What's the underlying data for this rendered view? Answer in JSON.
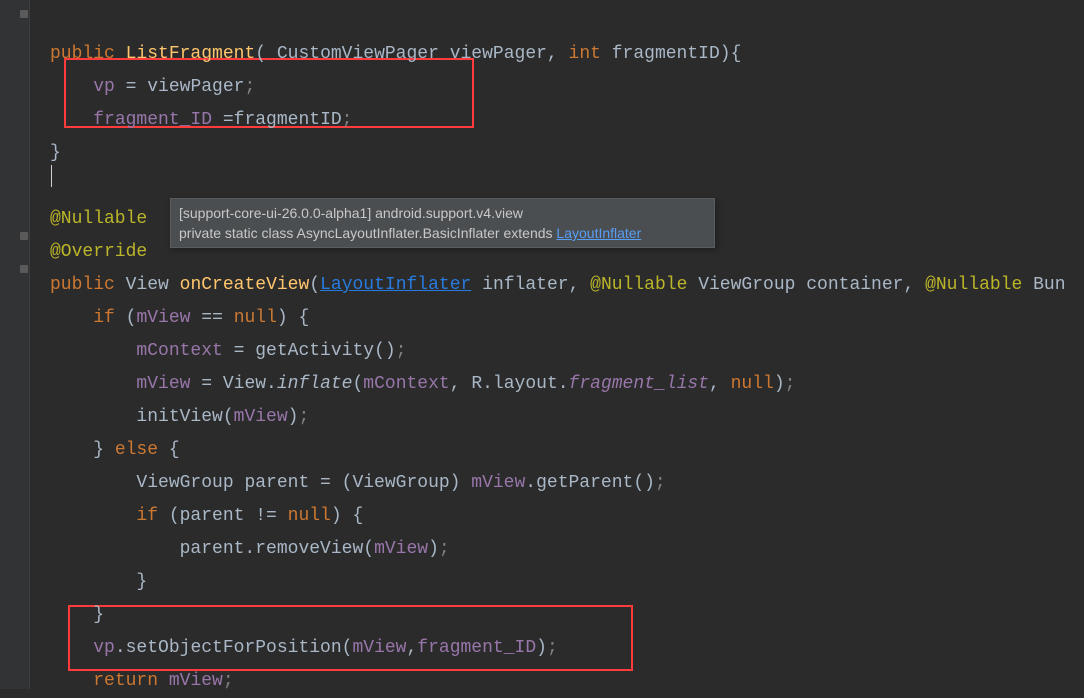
{
  "code": {
    "l1_public": "public",
    "l1_class": "ListFragment",
    "l1_paramType1": "CustomViewPager",
    "l1_paramName1": "viewPager",
    "l1_paramType2": "int",
    "l1_paramName2": "fragmentID",
    "l2_field": "vp",
    "l2_assign": " = viewPager",
    "l3_field": "fragment_ID",
    "l3_assign": " =fragmentID",
    "l4_brace": "}",
    "l6_anno": "@Nullable",
    "l7_anno": "@Override",
    "l8_public": "public",
    "l8_rettype": "View",
    "l8_method": "onCreateView",
    "l8_p1type": "LayoutInflater",
    "l8_p1name": "inflater",
    "l8_anno2": "@Nullable",
    "l8_p2type": "ViewGroup",
    "l8_p2name": "container",
    "l8_anno3": "@Nullable",
    "l8_p3type": "Bun",
    "l9_if": "if",
    "l9_cond_lhs": "mView",
    "l9_cond_op": " == ",
    "l9_cond_rhs": "null",
    "l10_lhs": "mContext",
    "l10_rhs": " = getActivity()",
    "l11_lhs": "mView",
    "l11_mid": " = View.",
    "l11_inflate": "inflate",
    "l11_p1": "mContext",
    "l11_p2a": "R.layout.",
    "l11_p2b": "fragment_list",
    "l11_p3": "null",
    "l12_call": "initView(",
    "l12_arg": "mView",
    "l13_else": "else",
    "l14_decl": "ViewGroup parent = (ViewGroup) ",
    "l14_field": "mView",
    "l14_call": ".getParent()",
    "l15_if": "if",
    "l15_cond": " (parent != ",
    "l15_null": "null",
    "l16_call": "parent.removeView(",
    "l16_arg": "mView",
    "l19_obj": "vp",
    "l19_call": ".setObjectForPosition(",
    "l19_a1": "mView",
    "l19_a2": "fragment_ID",
    "l20_ret": "return",
    "l20_val": "mView"
  },
  "tooltip": {
    "line1": "[support-core-ui-26.0.0-alpha1] android.support.v4.view",
    "line2a": "private static class AsyncLayoutInflater.BasicInflater extends ",
    "line2b": "LayoutInflater"
  }
}
